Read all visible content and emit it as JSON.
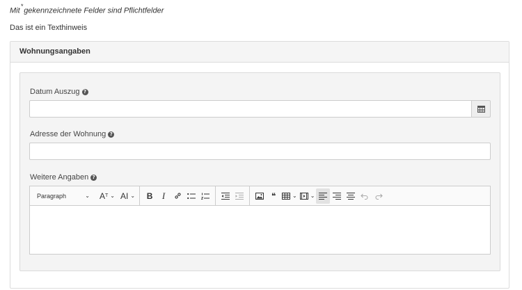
{
  "required_note": {
    "prefix": "Mit",
    "asterisk": "*",
    "suffix": "gekennzeichnete Felder sind Pflichtfelder"
  },
  "hint": "Das ist ein Texthinweis",
  "panel": {
    "title": "Wohnungsangaben"
  },
  "fields": {
    "move_out_date": {
      "label": "Datum Auszug",
      "value": "",
      "placeholder": ""
    },
    "address": {
      "label": "Adresse der Wohnung",
      "value": "",
      "placeholder": ""
    },
    "further_info": {
      "label": "Weitere Angaben",
      "value": ""
    }
  },
  "editor_toolbar": {
    "paragraph": "Paragraph",
    "font_size": "A",
    "font_family": "AI",
    "bold": "B",
    "italic": "I",
    "quote": "❝"
  },
  "help_icon": "?",
  "icons": [
    "help-icon",
    "calendar-icon",
    "chevron-down-icon",
    "bold-icon",
    "italic-icon",
    "link-icon",
    "bulleted-list-icon",
    "numbered-list-icon",
    "outdent-icon",
    "indent-icon",
    "image-icon",
    "blockquote-icon",
    "table-icon",
    "media-embed-icon",
    "align-left-icon",
    "align-right-icon",
    "align-center-icon",
    "undo-icon",
    "redo-icon"
  ]
}
